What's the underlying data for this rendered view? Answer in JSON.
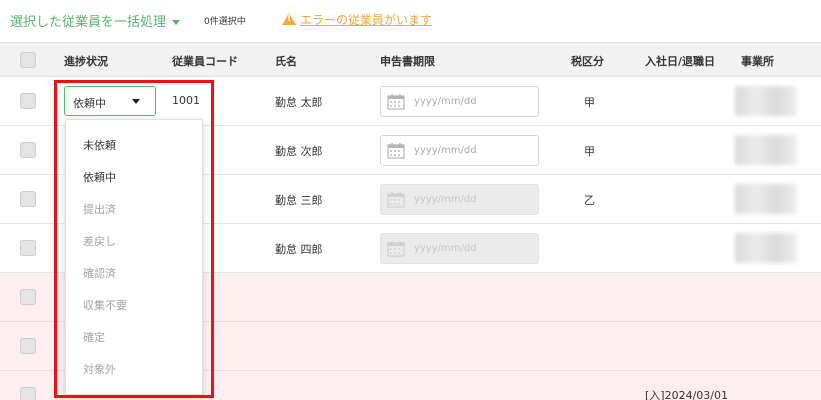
{
  "toolbar": {
    "bulk_action_label": "選択した従業員を一括処理",
    "selected_count": "0件選択中",
    "error_link": "エラーの従業員がいます"
  },
  "table": {
    "headers": [
      "進捗状況",
      "従業員コード",
      "氏名",
      "申告書期限",
      "税区分",
      "入社日/退職日",
      "事業所"
    ],
    "date_placeholder": "yyyy/mm/dd",
    "rows": [
      {
        "status": "依頼中",
        "code": "1001",
        "name": "勤怠 太郎",
        "tax": "甲"
      },
      {
        "name": "勤怠 次郎",
        "tax": "甲"
      },
      {
        "name": "勤怠 三郎",
        "tax": "乙"
      },
      {
        "name": "勤怠 四郎",
        "tax": ""
      },
      {},
      {},
      {
        "join_date": "[入]2024/03/01"
      }
    ]
  },
  "status_menu": {
    "options": [
      {
        "label": "未依頼",
        "enabled": true
      },
      {
        "label": "依頼中",
        "enabled": true
      },
      {
        "label": "提出済",
        "enabled": false
      },
      {
        "label": "差戻し",
        "enabled": false
      },
      {
        "label": "確認済",
        "enabled": false
      },
      {
        "label": "収集不要",
        "enabled": false
      },
      {
        "label": "確定",
        "enabled": false
      },
      {
        "label": "対象外",
        "enabled": false
      }
    ]
  },
  "colors": {
    "accent": "#55b36f",
    "warning": "#f0a93a",
    "error_row": "#fdeff1",
    "highlight": "#ee1111"
  },
  "icons": [
    "chevron-down-icon",
    "warning-icon",
    "calendar-icon"
  ]
}
